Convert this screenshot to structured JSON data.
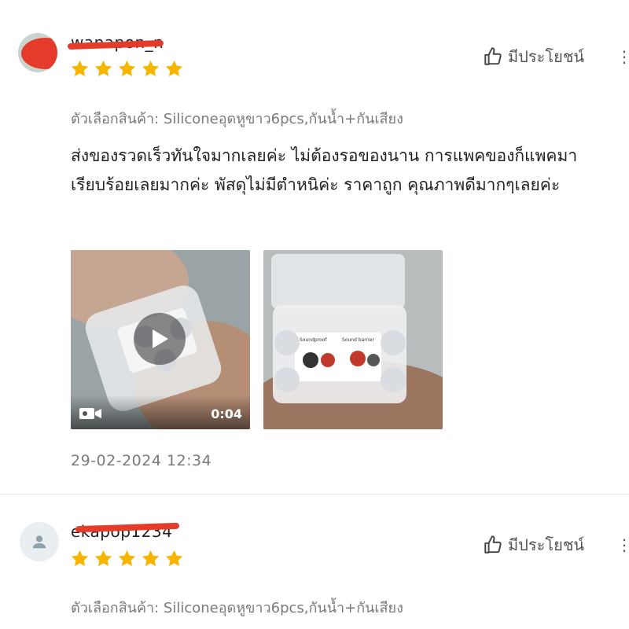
{
  "reviews": [
    {
      "username": "wanapon_n",
      "rating": 5,
      "helpful_label": "มีประโยชน์",
      "more_label": "⋮",
      "variant": "ตัวเลือกสินค้า: Siliconeอุดหูขาว6pcs,กันน้ำ+กันเสียง",
      "comment": "ส่งของรวดเร็วทันใจมากเลยค่ะ ไม่ต้องรอของนาน การแพคของก็แพคมาเรียบร้อยเลยมากค่ะ พัสดุไม่มีตำหนิค่ะ ราคาถูก คุณภาพดีมากๆเลยค่ะ",
      "media": [
        {
          "type": "video",
          "duration": "0:04",
          "icon": "video-camera-icon"
        },
        {
          "type": "image",
          "card_lines": [
            "Soundproof",
            "Sound barrier"
          ]
        }
      ],
      "date": "29-02-2024 12:34"
    },
    {
      "username": "ekapop1234",
      "rating": 5,
      "helpful_label": "มีประโยชน์",
      "more_label": "⋮",
      "variant": "ตัวเลือกสินค้า: Siliconeอุดหูขาว6pcs,กันน้ำ+กันเสียง"
    }
  ],
  "colors": {
    "star": "#f7b500",
    "redaction": "#e53b2a",
    "muted_text": "#7a7a7a"
  }
}
